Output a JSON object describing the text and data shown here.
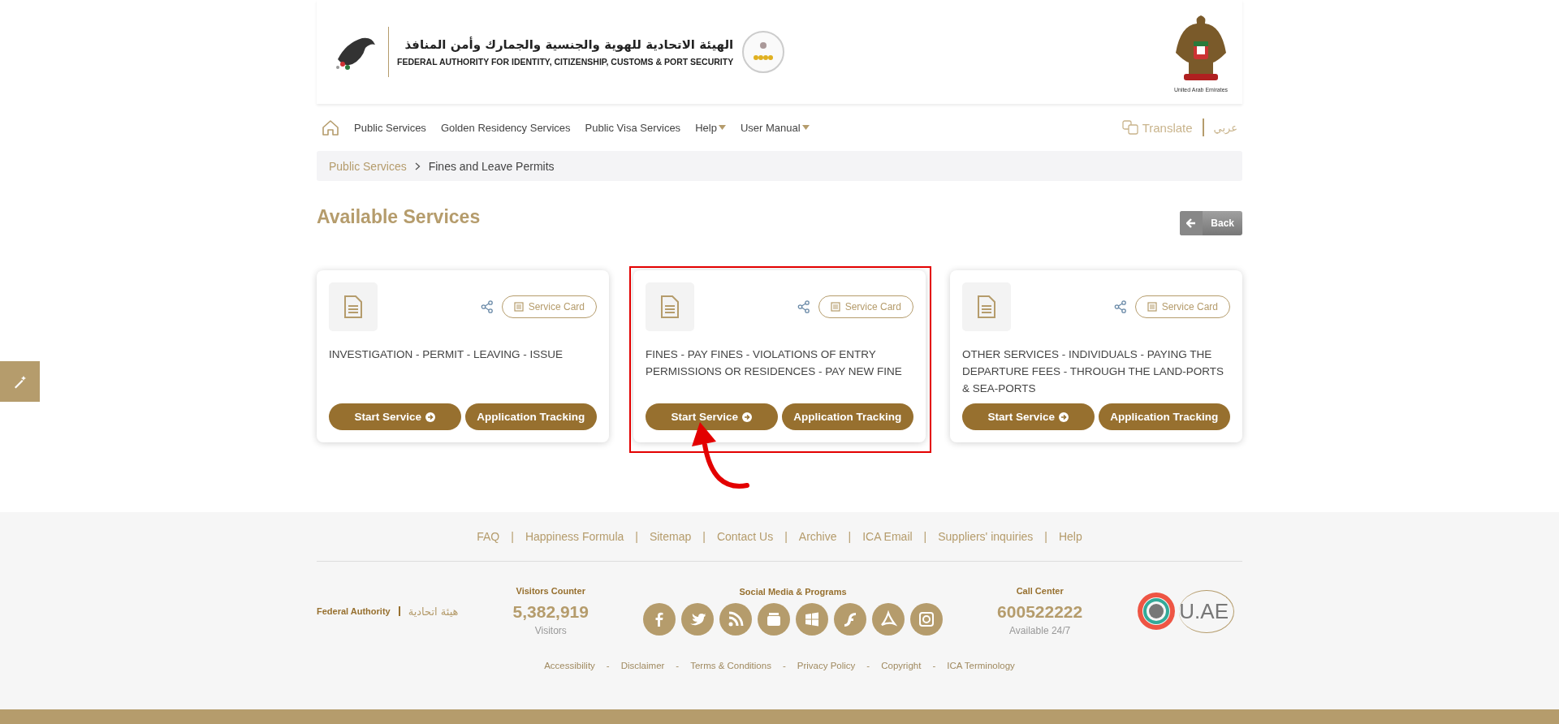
{
  "header": {
    "title_ar": "الهيئة الاتحادية للهوية والجنسية والجمارك وأمن المنافذ",
    "title_en": "FEDERAL AUTHORITY FOR IDENTITY, CITIZENSHIP, CUSTOMS & PORT SECURITY",
    "emblem_caption": "United Arab Emirates"
  },
  "nav": {
    "items": [
      {
        "label": "Public Services",
        "dropdown": false
      },
      {
        "label": "Golden Residency Services",
        "dropdown": false
      },
      {
        "label": "Public Visa Services",
        "dropdown": false
      },
      {
        "label": "Help",
        "dropdown": true
      },
      {
        "label": "User Manual",
        "dropdown": true
      }
    ],
    "translate": "Translate",
    "language": "عربي"
  },
  "breadcrumb": [
    "Public Services",
    "Fines and Leave Permits"
  ],
  "heading": "Available Services",
  "back_button": "Back",
  "services": [
    {
      "title": "INVESTIGATION - PERMIT - LEAVING - ISSUE",
      "service_card": "Service Card",
      "start": "Start Service",
      "tracking": "Application Tracking",
      "highlighted": false
    },
    {
      "title": "FINES - PAY FINES - VIOLATIONS OF ENTRY PERMISSIONS OR RESIDENCES - PAY NEW FINE",
      "service_card": "Service Card",
      "start": "Start Service",
      "tracking": "Application Tracking",
      "highlighted": true
    },
    {
      "title": "OTHER SERVICES - INDIVIDUALS - PAYING THE DEPARTURE FEES - THROUGH THE LAND-PORTS & SEA-PORTS",
      "service_card": "Service Card",
      "start": "Start Service",
      "tracking": "Application Tracking",
      "highlighted": false
    }
  ],
  "footer": {
    "links": [
      "FAQ",
      "Happiness Formula",
      "Sitemap",
      "Contact Us",
      "Archive",
      "ICA Email",
      "Suppliers' inquiries",
      "Help"
    ],
    "brand_en": "Federal Authority",
    "brand_ar": "هيئة اتحادية",
    "visitors_title": "Visitors Counter",
    "visitors_count": "5,382,919",
    "visitors_label": "Visitors",
    "social_title": "Social Media & Programs",
    "social": [
      {
        "kind": "facebook"
      },
      {
        "kind": "twitter"
      },
      {
        "kind": "rss"
      },
      {
        "kind": "youtube"
      },
      {
        "kind": "windows"
      },
      {
        "kind": "flash"
      },
      {
        "kind": "acrobat"
      },
      {
        "kind": "instagram"
      }
    ],
    "call_title": "Call Center",
    "call_number": "600522222",
    "call_hours": "Available 24/7",
    "uae_logo": "U.AE",
    "bottom_links": [
      "Accessibility",
      "Disclaimer",
      "Terms & Conditions",
      "Privacy Policy",
      "Copyright",
      "ICA Terminology"
    ],
    "bottom_separator": "-",
    "link_separator": "|"
  }
}
